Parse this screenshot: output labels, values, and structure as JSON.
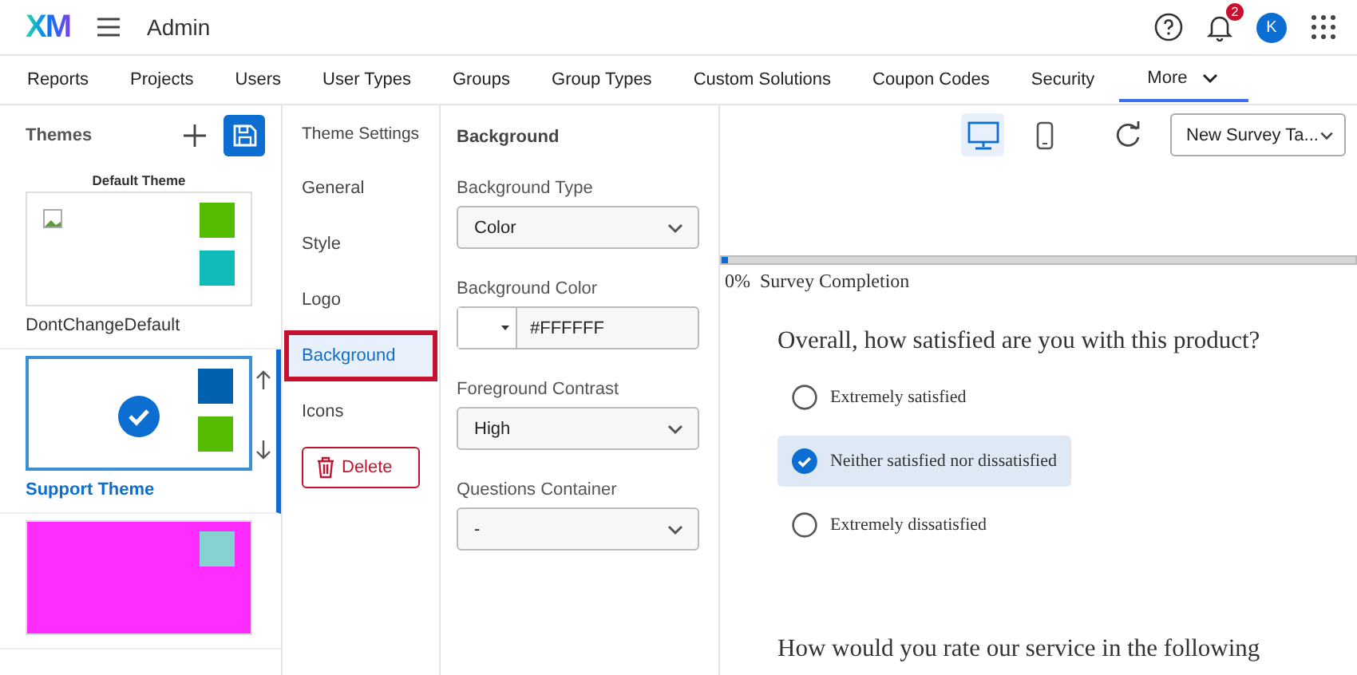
{
  "header": {
    "logo": "XM",
    "title": "Admin",
    "notifications": "2",
    "avatar": "K"
  },
  "nav_tabs": [
    {
      "label": "Reports",
      "selected": false
    },
    {
      "label": "Projects",
      "selected": false
    },
    {
      "label": "Users",
      "selected": false
    },
    {
      "label": "User Types",
      "selected": false
    },
    {
      "label": "Groups",
      "selected": false
    },
    {
      "label": "Group Types",
      "selected": false
    },
    {
      "label": "Custom Solutions",
      "selected": false
    },
    {
      "label": "Coupon Codes",
      "selected": false
    },
    {
      "label": "Security",
      "selected": false
    },
    {
      "label": "More",
      "selected": true
    }
  ],
  "themes": {
    "title": "Themes",
    "items": [
      {
        "heading": "Default Theme",
        "name": "DontChangeDefault",
        "selected": false,
        "broken_image": true,
        "color": "#ffffff",
        "swatches": [
          {
            "color": "#53bc00"
          },
          {
            "color": "#0fbbb8"
          }
        ]
      },
      {
        "name": "Support Theme",
        "selected": true,
        "broken_image": false,
        "color": "#ffffff",
        "swatches": [
          {
            "color": "#0061b0"
          },
          {
            "color": "#53bc00"
          }
        ]
      },
      {
        "selected": false,
        "broken_image": false,
        "color": "#ff2cff",
        "swatches": [
          {
            "color": "#86d2d0"
          }
        ]
      }
    ]
  },
  "settings_nav": {
    "title": "Theme Settings",
    "items": [
      {
        "label": "General",
        "selected": false
      },
      {
        "label": "Style",
        "selected": false
      },
      {
        "label": "Logo",
        "selected": false
      },
      {
        "label": "Background",
        "selected": true
      },
      {
        "label": "Icons",
        "selected": false
      }
    ],
    "delete": "Delete"
  },
  "form": {
    "title": "Background",
    "fields": [
      {
        "kind": "select",
        "label": "Background Type",
        "value": "Color"
      },
      {
        "kind": "color",
        "label": "Background Color",
        "value": "#FFFFFF",
        "color": "#ffffff"
      },
      {
        "kind": "select",
        "label": "Foreground Contrast",
        "value": "High"
      },
      {
        "kind": "select",
        "label": "Questions Container",
        "value": "-"
      }
    ]
  },
  "preview": {
    "devices": [
      {
        "kind": "desktop",
        "selected": true
      },
      {
        "kind": "mobile",
        "selected": false
      }
    ],
    "template": "New Survey Ta...",
    "progress": {
      "level": 0.01,
      "percent": "0%",
      "label": "Survey Completion"
    },
    "question": "Overall, how satisfied are you with this product?",
    "options": [
      {
        "label": "Extremely satisfied",
        "selected": false
      },
      {
        "label": "Neither satisfied nor dissatisfied",
        "selected": true
      },
      {
        "label": "Extremely dissatisfied",
        "selected": false
      }
    ],
    "next_question": "How would you rate our service in the following"
  }
}
